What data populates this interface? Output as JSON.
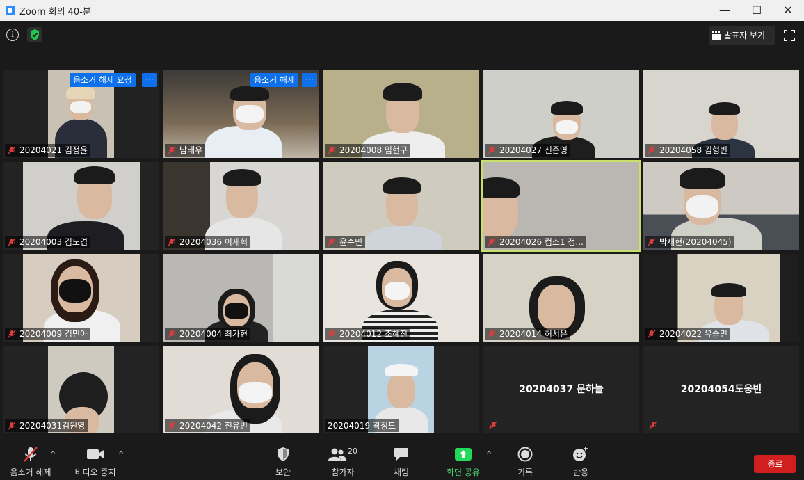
{
  "window": {
    "title": "Zoom 회의 40-분"
  },
  "topbar": {
    "speaker_view_label": "발표자 보기"
  },
  "overlay": {
    "unmute_request_label": "음소거 해제 요청",
    "unmute_label": "음소거 해제",
    "more_label": "···"
  },
  "participants": [
    "20204021 김정윤",
    "남태우",
    "20204008 임현구",
    "20204027 신준영",
    "20204058 김형빈",
    "20204003 김도겸",
    "20204036 이재혁",
    "윤수민",
    "20204026 컴소1 정...",
    "박재현(20204045)",
    "20204009 김민아",
    "20204004 최가현",
    "20204012 조혜진",
    "20204014 허서윤",
    "20204022 유승민",
    "20204031김원영",
    "20204042 전유빈",
    "20204019 곽정도",
    "20204037 문하늘",
    "20204054도웅빈"
  ],
  "toolbar": {
    "mute_label": "음소거 해제",
    "video_label": "비디오 중지",
    "security_label": "보안",
    "participants_label": "참가자",
    "participants_count": "20",
    "chat_label": "채팅",
    "share_label": "화면 공유",
    "record_label": "기록",
    "reactions_label": "반응",
    "end_label": "종료"
  },
  "colors": {
    "accent_blue": "#0e71eb",
    "end_red": "#d11f1f",
    "share_green": "#23d959",
    "active_speaker": "#c8e06a"
  }
}
